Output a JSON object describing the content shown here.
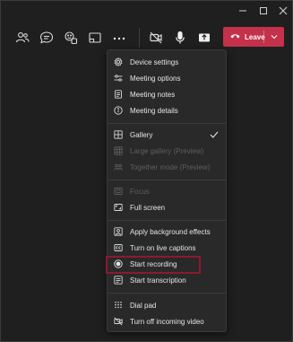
{
  "window": {
    "minimize_icon": "minimize-icon",
    "maximize_icon": "maximize-icon",
    "close_icon": "close-icon"
  },
  "toolbar": {
    "icons": [
      "people-icon",
      "chat-icon",
      "reactions-icon",
      "share-tray-icon",
      "more-actions-icon",
      "camera-off-icon",
      "microphone-icon",
      "share-screen-icon"
    ],
    "leave_label": "Leave",
    "leave_color": "#c4314b"
  },
  "menu": {
    "items": [
      {
        "label": "Device settings",
        "icon": "gear-icon",
        "enabled": true
      },
      {
        "label": "Meeting options",
        "icon": "sliders-icon",
        "enabled": true
      },
      {
        "label": "Meeting notes",
        "icon": "notes-icon",
        "enabled": true
      },
      {
        "label": "Meeting details",
        "icon": "info-icon",
        "enabled": true
      },
      {
        "label": "Gallery",
        "icon": "gallery-icon",
        "enabled": true,
        "checked": true
      },
      {
        "label": "Large gallery (Preview)",
        "icon": "large-gallery-icon",
        "enabled": false
      },
      {
        "label": "Together mode (Preview)",
        "icon": "together-mode-icon",
        "enabled": false
      },
      {
        "label": "Focus",
        "icon": "focus-icon",
        "enabled": false
      },
      {
        "label": "Full screen",
        "icon": "fullscreen-icon",
        "enabled": true
      },
      {
        "label": "Apply background effects",
        "icon": "background-effects-icon",
        "enabled": true
      },
      {
        "label": "Turn on live captions",
        "icon": "captions-icon",
        "enabled": true
      },
      {
        "label": "Start recording",
        "icon": "record-icon",
        "enabled": true,
        "highlighted": true
      },
      {
        "label": "Start transcription",
        "icon": "transcription-icon",
        "enabled": true
      },
      {
        "label": "Dial pad",
        "icon": "dialpad-icon",
        "enabled": true
      },
      {
        "label": "Turn off incoming video",
        "icon": "video-off-icon",
        "enabled": true
      }
    ],
    "highlight_color": "#8b1a2e"
  }
}
